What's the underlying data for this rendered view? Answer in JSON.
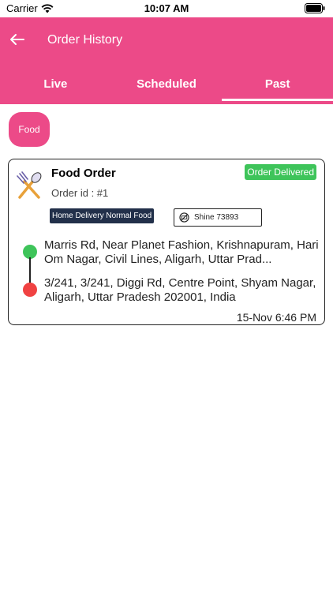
{
  "status_bar": {
    "carrier": "Carrier",
    "time": "10:07 AM"
  },
  "header": {
    "title": "Order History"
  },
  "tabs": [
    {
      "label": "Live",
      "active": false
    },
    {
      "label": "Scheduled",
      "active": false
    },
    {
      "label": "Past",
      "active": true
    }
  ],
  "filter_chip": {
    "label": "Food"
  },
  "order": {
    "title": "Food Order",
    "order_id": "Order id : #1",
    "status": "Order Delivered",
    "delivery_tag": "Home Delivery Normal Food",
    "driver_tag": "Shine 73893",
    "pickup_address": "Marris Rd, Near Planet Fashion, Krishnapuram, Hari Om Nagar, Civil Lines, Aligarh, Uttar Prad...",
    "drop_address": "3/241, 3/241, Diggi Rd, Centre Point, Shyam Nagar, Aligarh, Uttar Pradesh 202001, India",
    "datetime": "15-Nov 6:46 PM"
  },
  "colors": {
    "accent": "#ec4a88",
    "delivered": "#3ec45a",
    "drop": "#f04242",
    "tag_dark": "#22304a"
  }
}
